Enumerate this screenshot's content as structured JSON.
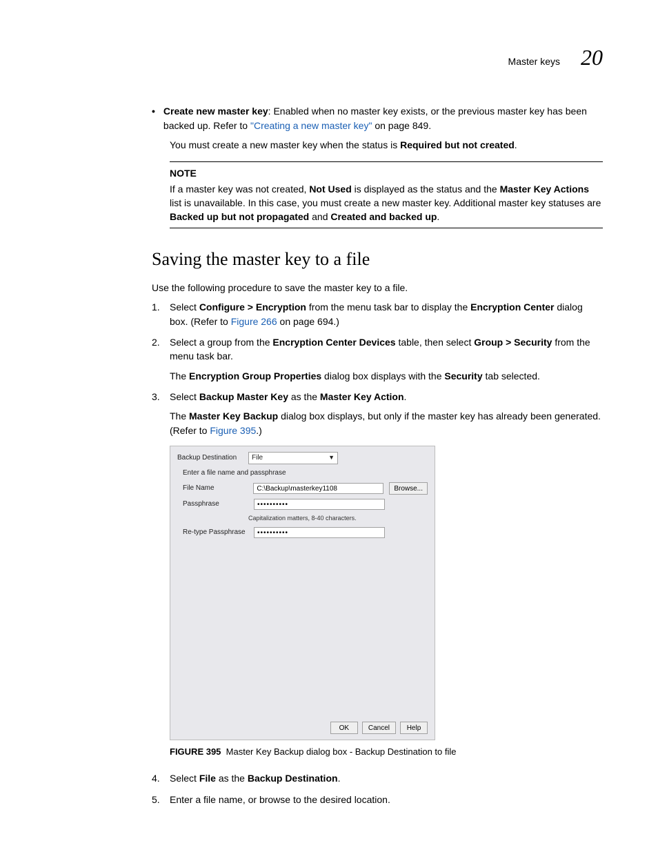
{
  "header": {
    "section": "Master keys",
    "chapter": "20"
  },
  "bullet": {
    "lead": "Create new master key",
    "rest": ": Enabled when no master key exists, or the previous master key has been backed up. Refer to ",
    "link": "\"Creating a new master key\"",
    "tail": " on page 849."
  },
  "para_status": {
    "pre": "You must create a new master key when the status is ",
    "bold": "Required but not created",
    "post": "."
  },
  "note": {
    "label": "NOTE",
    "l1a": "If a master key was not created, ",
    "l1b": "Not Used",
    "l1c": " is displayed as the status and the ",
    "l1d": "Master Key Actions",
    "l1e": " list is unavailable. In this case, you must create a new master key. Additional master key statuses are ",
    "l1f": "Backed up but not propagated",
    "l1g": " and ",
    "l1h": "Created and backed up",
    "l1i": "."
  },
  "section_heading": "Saving the master key to a file",
  "intro": "Use the following procedure to save the master key to a file.",
  "steps": {
    "s1": {
      "a": "Select ",
      "b": "Configure > Encryption",
      "c": " from the menu task bar to display the ",
      "d": "Encryption Center",
      "e": " dialog box. (Refer to ",
      "link": "Figure 266",
      "f": " on page 694.)"
    },
    "s2": {
      "a": "Select a group from the ",
      "b": "Encryption Center Devices",
      "c": " table, then select ",
      "d": "Group > Security",
      "e": " from the menu task bar.",
      "sub_a": "The ",
      "sub_b": "Encryption Group Properties",
      "sub_c": " dialog box displays with the ",
      "sub_d": "Security",
      "sub_e": " tab selected."
    },
    "s3": {
      "a": "Select ",
      "b": "Backup Master Key",
      "c": " as the ",
      "d": "Master Key Action",
      "e": ".",
      "sub_a": "The ",
      "sub_b": "Master Key Backup",
      "sub_c": " dialog box displays, but only if the master key has already been generated. (Refer to ",
      "link": "Figure 395",
      "sub_d": ".)"
    },
    "s4": {
      "a": "Select ",
      "b": "File",
      "c": " as the ",
      "d": "Backup Destination",
      "e": "."
    },
    "s5": {
      "a": "Enter a file name, or browse to the desired location."
    }
  },
  "dialog": {
    "backup_dest_label": "Backup Destination",
    "backup_dest_value": "File",
    "instruction": "Enter a file name and passphrase",
    "file_name_label": "File Name",
    "file_name_value": "C:\\Backup\\masterkey1108",
    "browse": "Browse...",
    "passphrase_label": "Passphrase",
    "passphrase_value": "••••••••••",
    "hint": "Capitalization matters, 8-40 characters.",
    "retype_label": "Re-type Passphrase",
    "retype_value": "••••••••••",
    "ok": "OK",
    "cancel": "Cancel",
    "help": "Help"
  },
  "figure": {
    "num": "FIGURE 395",
    "caption": "Master Key Backup dialog box - Backup Destination to file"
  }
}
